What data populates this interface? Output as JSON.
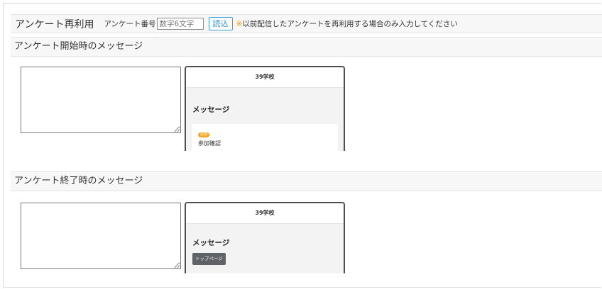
{
  "reuse": {
    "title": "アンケート再利用",
    "number_label": "アンケート番号",
    "number_placeholder": "数字6文字",
    "load_button": "読込",
    "note_mark": "※",
    "note": "以前配信したアンケートを再利用する場合のみ入力してください"
  },
  "start_section": {
    "header": "アンケート開始時のメッセージ",
    "textarea_value": "",
    "preview": {
      "school_name": "39学校",
      "heading": "メッセージ",
      "badge": "必須",
      "card_title": "参加確認"
    }
  },
  "end_section": {
    "header": "アンケート終了時のメッセージ",
    "textarea_value": "",
    "preview": {
      "school_name": "39学校",
      "heading": "メッセージ",
      "top_button": "トップページ"
    }
  },
  "colors": {
    "note_mark": "#f0a000",
    "load_button": "#2f8fd0",
    "badge": "#f5a623",
    "top_button": "#5f6368"
  }
}
